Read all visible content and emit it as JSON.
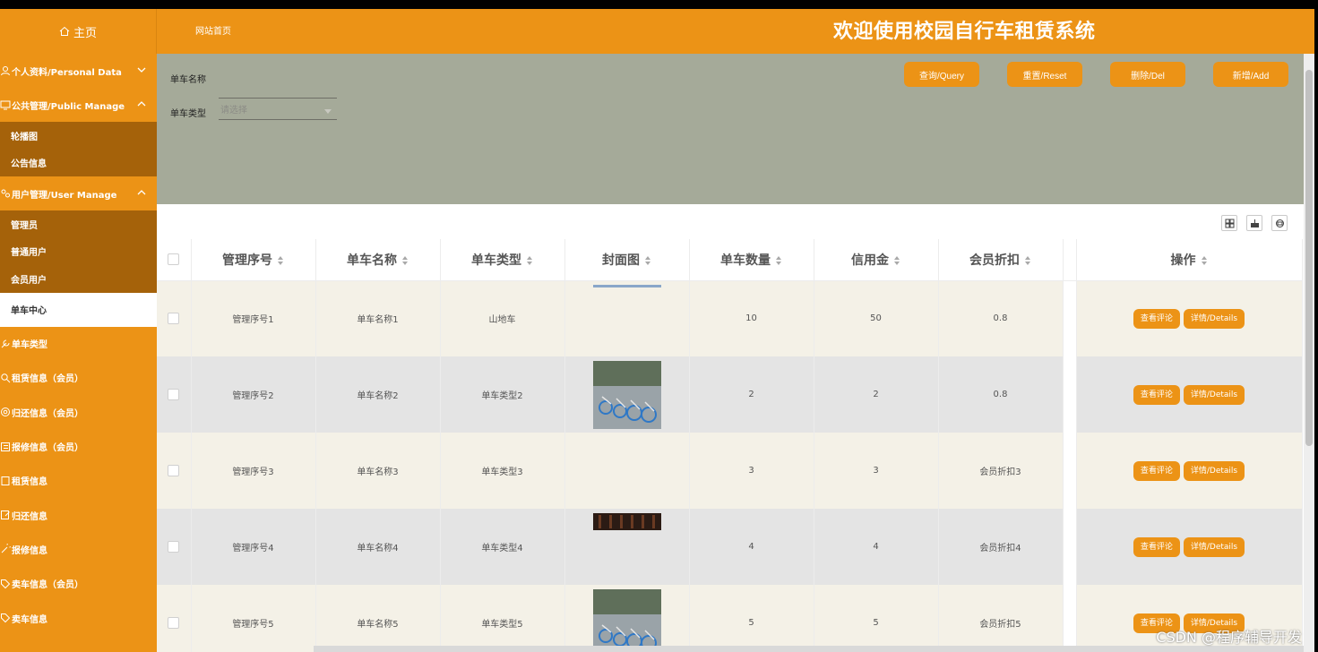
{
  "header": {
    "home_label": "主页",
    "site_home_link": "网站首页",
    "system_title": "欢迎使用校园自行车租赁系统"
  },
  "sidebar": {
    "personal": "个人资料/Personal Data",
    "public_manage": "公共管理/Public Manage",
    "public_items": [
      "轮播图",
      "公告信息"
    ],
    "user_manage": "用户管理/User Manage",
    "user_items": [
      "管理员",
      "普通用户",
      "会员用户"
    ],
    "active_item": "单车中心",
    "other_items": [
      "单车类型",
      "租赁信息（会员）",
      "归还信息（会员）",
      "报修信息（会员）",
      "租赁信息",
      "归还信息",
      "报修信息",
      "卖车信息（会员）",
      "卖车信息"
    ]
  },
  "search": {
    "name_label": "单车名称",
    "name_value": "",
    "type_label": "单车类型",
    "type_placeholder": "请选择",
    "buttons": {
      "query": "查询/Query",
      "reset": "重置/Reset",
      "delete": "删除/Del",
      "add": "新增/Add"
    }
  },
  "table": {
    "columns": [
      "管理序号",
      "单车名称",
      "单车类型",
      "封面图",
      "单车数量",
      "信用金",
      "会员折扣",
      "操作"
    ],
    "rows": [
      {
        "serial": "管理序号1",
        "name": "单车名称1",
        "type": "山地车",
        "cover": "strip",
        "count": "10",
        "deposit": "50",
        "discount": "0.8"
      },
      {
        "serial": "管理序号2",
        "name": "单车名称2",
        "type": "单车类型2",
        "cover": "bikes",
        "count": "2",
        "deposit": "2",
        "discount": "0.8"
      },
      {
        "serial": "管理序号3",
        "name": "单车名称3",
        "type": "单车类型3",
        "cover": "",
        "count": "3",
        "deposit": "3",
        "discount": "会员折扣3"
      },
      {
        "serial": "管理序号4",
        "name": "单车名称4",
        "type": "单车类型4",
        "cover": "dark",
        "count": "4",
        "deposit": "4",
        "discount": "会员折扣4"
      },
      {
        "serial": "管理序号5",
        "name": "单车名称5",
        "type": "单车类型5",
        "cover": "bikes",
        "count": "5",
        "deposit": "5",
        "discount": "会员折扣5"
      }
    ],
    "row_actions": {
      "comments": "查看评论",
      "details": "详情/Details"
    }
  },
  "watermark": "CSDN @程序辅导开发",
  "colors": {
    "accent": "#ec9316",
    "sidebar_dark": "#a5620a",
    "search_bg": "#a5aa99"
  }
}
